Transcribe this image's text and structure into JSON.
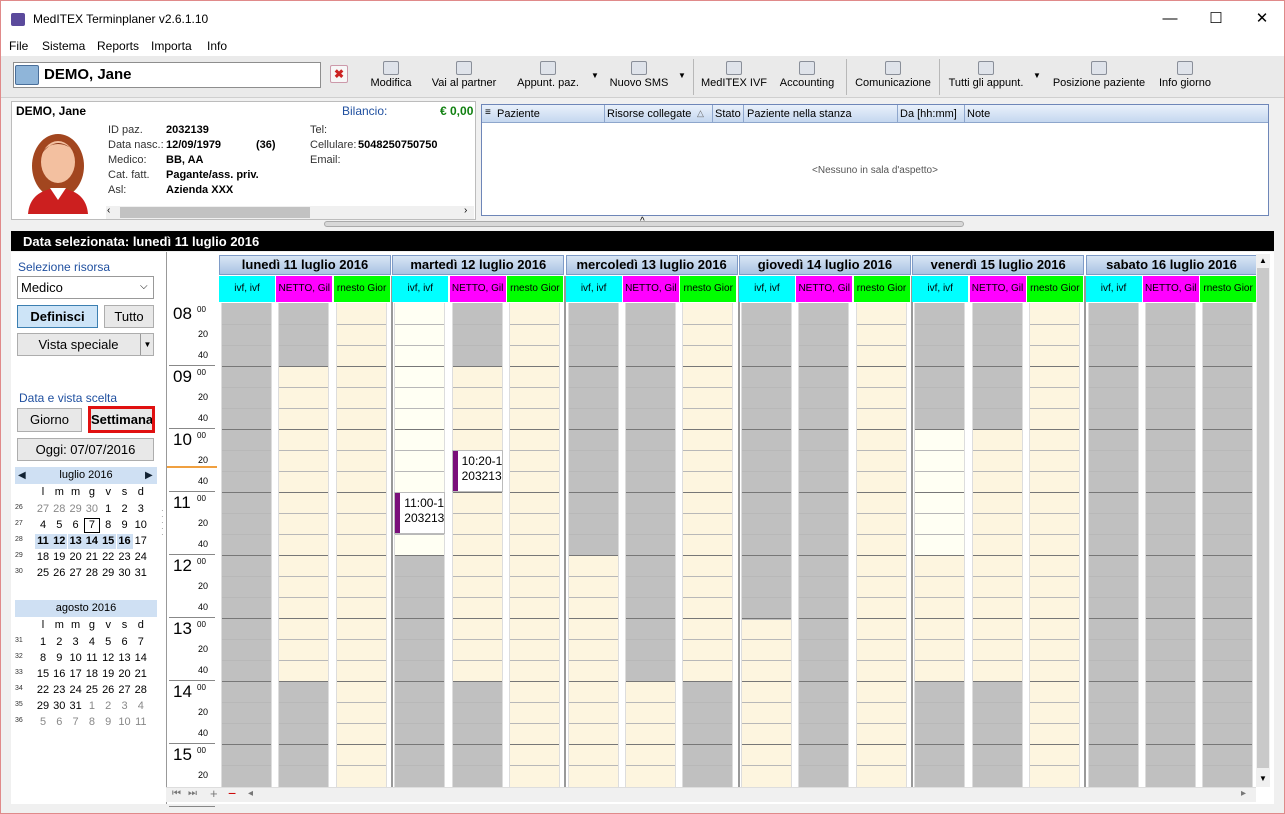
{
  "window": {
    "title": "MedITEX Terminplaner  v2.6.1.10",
    "min": "—",
    "max": "☐",
    "close": "✕"
  },
  "menu": [
    "File",
    "Sistema",
    "Reports",
    "Importa",
    "Info"
  ],
  "patient": {
    "name": "DEMO, Jane",
    "clear": "✖"
  },
  "toolbar": [
    "Modifica",
    "Vai al partner",
    "Appunt. paz.",
    "Nuovo SMS",
    "MedITEX IVF",
    "Accounting",
    "Comunicazione",
    "Tutti gli appunt.",
    "Posizione paziente",
    "Info giorno"
  ],
  "patinfo": {
    "name": "DEMO, Jane",
    "balance_label": "Bilancio:",
    "balance": "€ 0,00",
    "fields": [
      {
        "l": "ID paz.",
        "v": "2032139"
      },
      {
        "l": "Data nasc.:",
        "v": "12/09/1979",
        "extra": "(36)"
      },
      {
        "l": "Medico:",
        "v": "BB, AA"
      },
      {
        "l": "Cat. fatt.",
        "v": "Pagante/ass. priv."
      },
      {
        "l": "Asl:",
        "v": "Azienda XXX"
      }
    ],
    "right": [
      {
        "l": "Tel:",
        "v": ""
      },
      {
        "l": "Cellulare:",
        "v": "5048250750750"
      },
      {
        "l": "Email:",
        "v": ""
      }
    ]
  },
  "waitroom": {
    "cols": [
      "Paziente",
      "Risorse collegate",
      "Stato",
      "Paziente nella stanza",
      "Da [hh:mm]",
      "Note"
    ],
    "empty": "<Nessuno in sala d'aspetto>"
  },
  "selected_date": "Data selezionata:  lunedì 11 luglio 2016",
  "left": {
    "sel_res": "Selezione risorsa",
    "res_value": "Medico",
    "define": "Definisci",
    "all": "Tutto",
    "special": "Vista speciale",
    "date_view": "Data e vista scelta",
    "day": "Giorno",
    "week": "Settimana",
    "today": "Oggi: 07/07/2016",
    "cal1": {
      "title": "luglio 2016",
      "dows": [
        "l",
        "m",
        "m",
        "g",
        "v",
        "s",
        "d"
      ],
      "weeks": [
        "26",
        "27",
        "28",
        "29",
        "30"
      ],
      "rows": [
        [
          "27",
          "28",
          "29",
          "30",
          "1",
          "2",
          "3"
        ],
        [
          "4",
          "5",
          "6",
          "7",
          "8",
          "9",
          "10"
        ],
        [
          "11",
          "12",
          "13",
          "14",
          "15",
          "16",
          "17"
        ],
        [
          "18",
          "19",
          "20",
          "21",
          "22",
          "23",
          "24"
        ],
        [
          "25",
          "26",
          "27",
          "28",
          "29",
          "30",
          "31"
        ]
      ]
    },
    "cal2": {
      "title": "agosto 2016",
      "dows": [
        "l",
        "m",
        "m",
        "g",
        "v",
        "s",
        "d"
      ],
      "weeks": [
        "31",
        "32",
        "33",
        "34",
        "35",
        "36"
      ],
      "rows": [
        [
          "1",
          "2",
          "3",
          "4",
          "5",
          "6",
          "7"
        ],
        [
          "8",
          "9",
          "10",
          "11",
          "12",
          "13",
          "14"
        ],
        [
          "15",
          "16",
          "17",
          "18",
          "19",
          "20",
          "21"
        ],
        [
          "22",
          "23",
          "24",
          "25",
          "26",
          "27",
          "28"
        ],
        [
          "29",
          "30",
          "31",
          "1",
          "2",
          "3",
          "4"
        ],
        [
          "5",
          "6",
          "7",
          "8",
          "9",
          "10",
          "11"
        ]
      ]
    }
  },
  "days": [
    "lunedì 11 luglio 2016",
    "martedì 12 luglio 2016",
    "mercoledì 13 luglio 2016",
    "giovedì 14 luglio 2016",
    "venerdì 15 luglio 2016",
    "sabato 16 luglio 2016"
  ],
  "resources": [
    "ivf, ivf",
    "NETTO, Gil",
    "rnesto Gior"
  ],
  "hours": [
    "08",
    "09",
    "10",
    "11",
    "12",
    "13",
    "14",
    "15"
  ],
  "minute_labels": [
    "00",
    "20",
    "40"
  ],
  "appointments": [
    {
      "time": "10:20-1",
      "id": "203213"
    },
    {
      "time": "11:00-1",
      "id": "203213"
    }
  ],
  "colors": {
    "cyan": "#00ffff",
    "magenta": "#ff00ff",
    "green": "#00ff00",
    "grey": "#c0c0c0",
    "cream": "#fdf5df",
    "appt": "#7a0f7a"
  }
}
